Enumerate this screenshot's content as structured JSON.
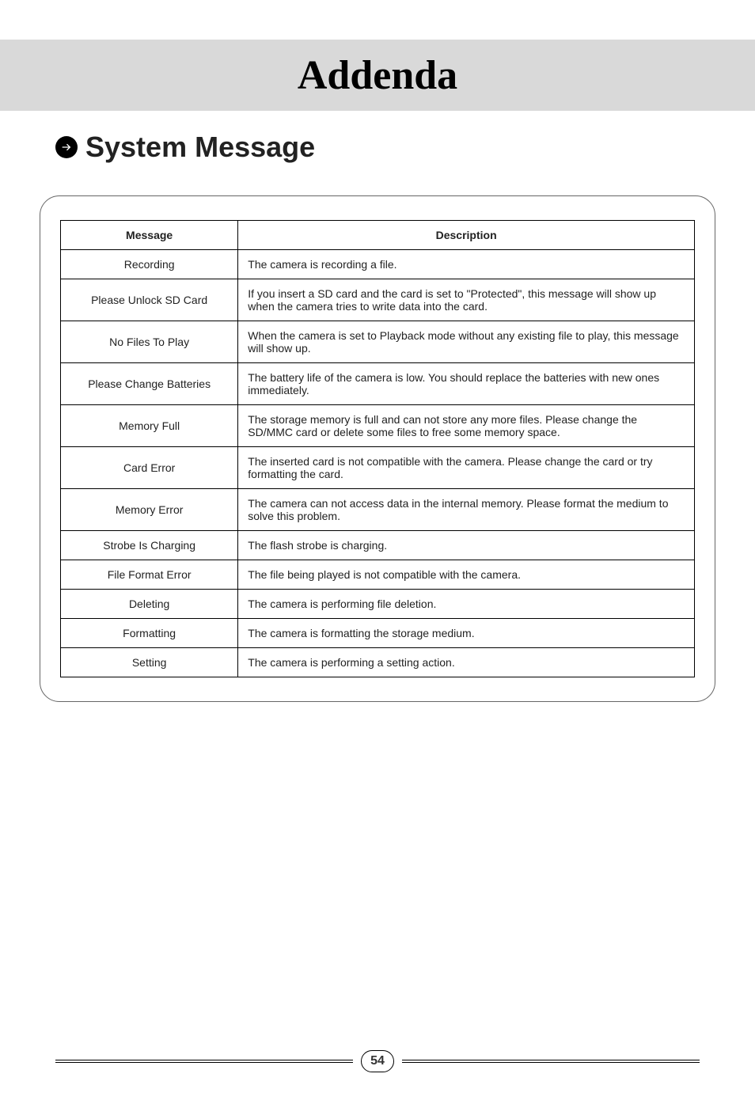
{
  "title": "Addenda",
  "section": "System Message",
  "table": {
    "headers": {
      "message": "Message",
      "description": "Description"
    },
    "rows": [
      {
        "msg": "Recording",
        "desc": "The camera is recording a file."
      },
      {
        "msg": "Please Unlock SD Card",
        "desc": "If you insert a SD card and the card is set to \"Protected\", this message will show up when the camera tries to write data into the card."
      },
      {
        "msg": "No Files To Play",
        "desc": "When the camera is set to Playback mode without any existing file to play, this message will show up."
      },
      {
        "msg": "Please Change Batteries",
        "desc": "The battery life of the camera is low. You should replace the batteries with new ones immediately."
      },
      {
        "msg": "Memory Full",
        "desc": "The storage memory is full and can not store any more files. Please change the SD/MMC card or delete some files to free some memory space."
      },
      {
        "msg": "Card Error",
        "desc": "The inserted card is not compatible with the camera. Please change the card or try formatting the card."
      },
      {
        "msg": "Memory Error",
        "desc": "The camera can not access data in the internal memory. Please format the medium to solve this problem."
      },
      {
        "msg": "Strobe Is Charging",
        "desc": "The flash strobe is charging."
      },
      {
        "msg": "File Format Error",
        "desc": "The file being played is not compatible with the camera."
      },
      {
        "msg": "Deleting",
        "desc": "The camera is performing file deletion."
      },
      {
        "msg": "Formatting",
        "desc": "The camera is formatting the storage medium."
      },
      {
        "msg": "Setting",
        "desc": "The camera is performing a setting action."
      }
    ]
  },
  "page_number": "54"
}
